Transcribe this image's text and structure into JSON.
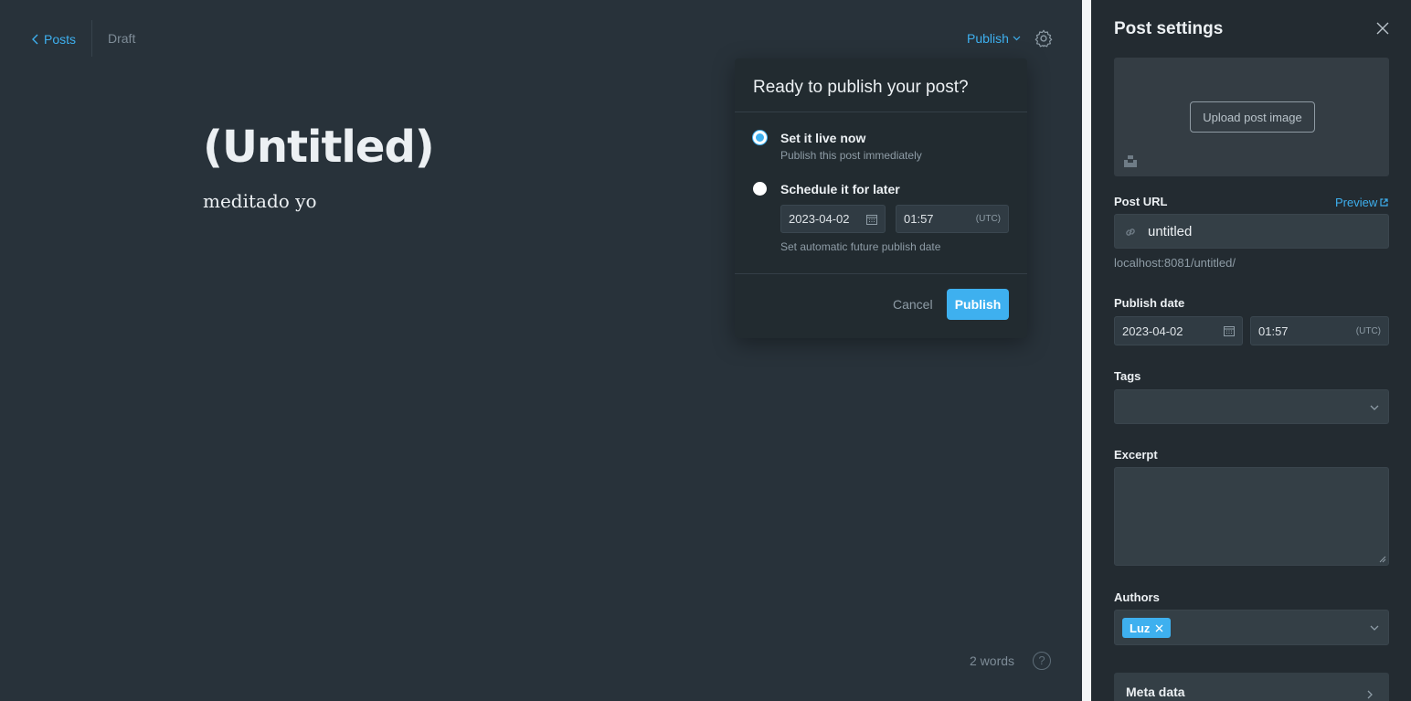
{
  "editor": {
    "back_label": "Posts",
    "status": "Draft",
    "publish_menu_label": "Publish",
    "title": "(Untitled)",
    "body": "meditado yo",
    "word_count": "2 words",
    "help_glyph": "?"
  },
  "publish_popover": {
    "title": "Ready to publish your post?",
    "option_now": {
      "label": "Set it live now",
      "description": "Publish this post immediately",
      "selected": true
    },
    "option_later": {
      "label": "Schedule it for later",
      "date": "2023-04-02",
      "time": "01:57",
      "timezone": "(UTC)",
      "description": "Set automatic future publish date",
      "selected": false
    },
    "cancel_label": "Cancel",
    "publish_label": "Publish"
  },
  "settings": {
    "title": "Post settings",
    "upload_label": "Upload post image",
    "post_url_label": "Post URL",
    "preview_label": "Preview",
    "slug": "untitled",
    "url_hint": "localhost:8081/untitled/",
    "publish_date_label": "Publish date",
    "date": "2023-04-02",
    "time": "01:57",
    "timezone": "(UTC)",
    "tags_label": "Tags",
    "excerpt_label": "Excerpt",
    "authors_label": "Authors",
    "author_chip": "Luz",
    "meta_label": "Meta data"
  },
  "colors": {
    "accent": "#3eb0ef",
    "background": "#28323a",
    "panel": "#232b31"
  }
}
